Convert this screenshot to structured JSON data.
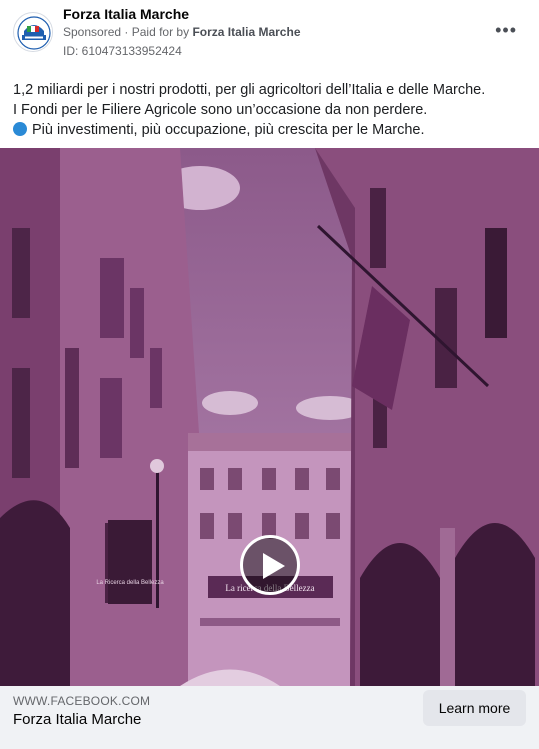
{
  "header": {
    "page_name": "Forza Italia Marche",
    "sponsored": "Sponsored",
    "paid_for_prefix": "Paid for by",
    "paid_for_by": "Forza Italia Marche",
    "ad_id": "ID: 610473133952424",
    "more_icon": "more-horizontal-icon"
  },
  "post": {
    "lines": [
      "1,2 miliardi per i nostri prodotti, per gli agricoltori dell’Italia e delle Marche.",
      "I Fondi per le Filiere Agricole sono un’occasione da non perdere.",
      "Più investimenti, più occupazione, più crescita per le Marche."
    ],
    "bullet_icon": "blue-circle-icon"
  },
  "media": {
    "type": "video",
    "play_icon": "play-icon",
    "banner_text": "La ricerca della Bellezza",
    "poster_text": "La Ricerca della Bellezza"
  },
  "footer": {
    "domain": "WWW.FACEBOOK.COM",
    "title": "Forza Italia Marche",
    "cta_label": "Learn more"
  },
  "colors": {
    "tint": "#b279a2",
    "cta_bg": "#e4e6eb",
    "footer_bg": "#f0f2f5",
    "bullet": "#2a8ad6"
  }
}
